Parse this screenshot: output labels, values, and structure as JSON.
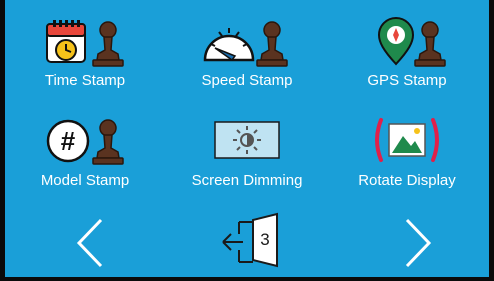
{
  "tiles": [
    {
      "label": "Time Stamp",
      "icon": "calendar-clock-stamp-icon"
    },
    {
      "label": "Speed Stamp",
      "icon": "speedometer-stamp-icon"
    },
    {
      "label": "GPS Stamp",
      "icon": "map-pin-stamp-icon"
    },
    {
      "label": "Model Stamp",
      "icon": "hash-stamp-icon"
    },
    {
      "label": "Screen Dimming",
      "icon": "brightness-icon"
    },
    {
      "label": "Rotate Display",
      "icon": "rotate-image-icon"
    }
  ],
  "nav": {
    "prev_icon": "chevron-left-icon",
    "next_icon": "chevron-right-icon",
    "exit_icon": "door-exit-icon",
    "page_number": "3"
  },
  "colors": {
    "background": "#1a9fd8",
    "stamp_brown": "#5a3320",
    "rotate_red": "#e0204a",
    "calendar_red": "#e8473b",
    "clock_yellow": "#f6c21a",
    "image_green": "#1f8a4c"
  }
}
